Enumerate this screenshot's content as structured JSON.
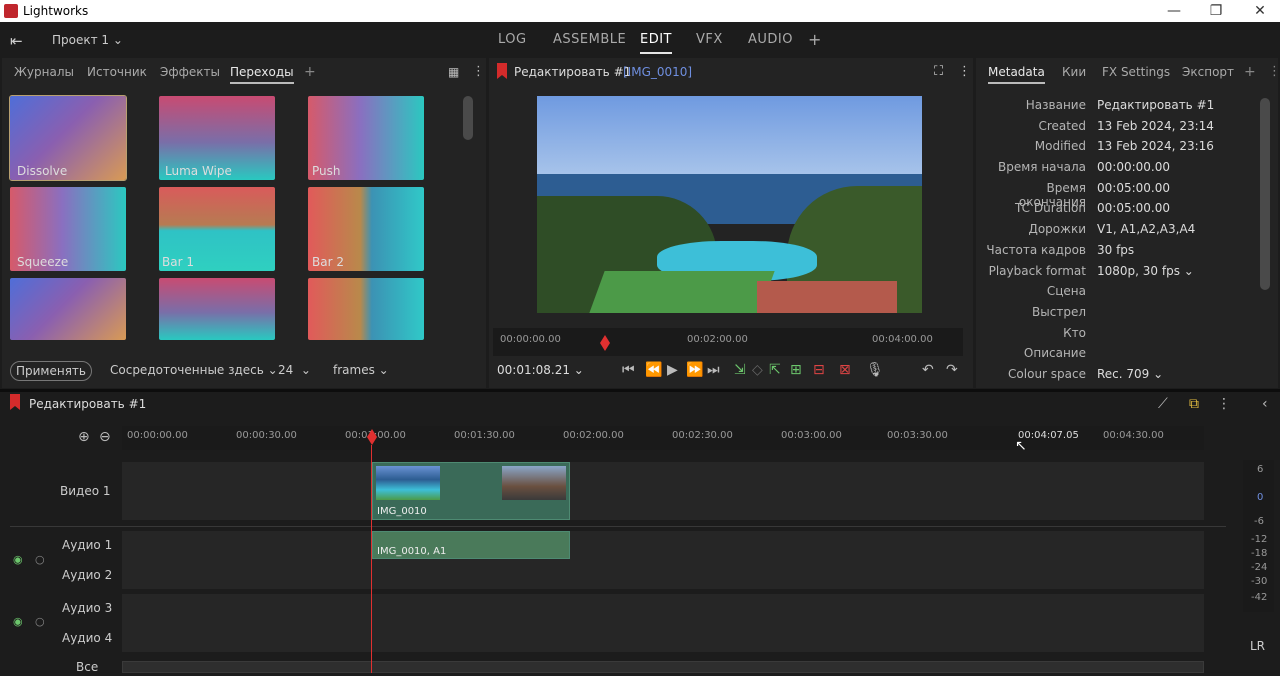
{
  "window": {
    "title": "Lightworks",
    "minimize": "—",
    "maximize": "❐",
    "close": "✕"
  },
  "topbar": {
    "project": "Проект 1",
    "nav": [
      "LOG",
      "ASSEMBLE",
      "EDIT",
      "VFX",
      "AUDIO"
    ],
    "active": "EDIT",
    "add": "+"
  },
  "left_panel": {
    "tabs": [
      "Журналы",
      "Источник",
      "Эффекты",
      "Переходы"
    ],
    "active_tab": "Переходы",
    "transitions": [
      "Dissolve",
      "Luma Wipe",
      "Push",
      "Squeeze",
      "Bar 1",
      "Bar 2"
    ],
    "apply": "Применять",
    "centered": "Сосредоточенные здесь",
    "duration": "24",
    "unit": "frames"
  },
  "viewer": {
    "title": "Редактировать #1",
    "clip": "[IMG_0010]",
    "ruler": [
      "00:00:00.00",
      "00:02:00.00",
      "00:04:00.00"
    ],
    "timecode": "00:01:08.21"
  },
  "metadata": {
    "tabs": [
      "Metadata",
      "Кии",
      "FX Settings",
      "Экспорт"
    ],
    "active_tab": "Metadata",
    "rows": [
      {
        "label": "Название",
        "value": "Редактировать #1"
      },
      {
        "label": "Created",
        "value": "13 Feb 2024, 23:14"
      },
      {
        "label": "Modified",
        "value": "13 Feb 2024, 23:16"
      },
      {
        "label": "Время начала",
        "value": "00:00:00.00"
      },
      {
        "label": "Время окончания",
        "value": "00:05:00.00"
      },
      {
        "label": "TC Duration",
        "value": "00:05:00.00"
      },
      {
        "label": "Дорожки",
        "value": "V1, A1,A2,A3,A4"
      },
      {
        "label": "Частота кадров",
        "value": "30 fps"
      },
      {
        "label": "Playback format",
        "value": "1080p, 30 fps ⌄"
      },
      {
        "label": "Сцена",
        "value": ""
      },
      {
        "label": "Выстрел",
        "value": ""
      },
      {
        "label": "Кто",
        "value": ""
      },
      {
        "label": "Описание",
        "value": ""
      },
      {
        "label": "Colour space",
        "value": "Rec. 709 ⌄"
      }
    ]
  },
  "timeline": {
    "title": "Редактировать #1",
    "ticks": [
      "00:00:00.00",
      "00:00:30.00",
      "00:01:00.00",
      "00:01:30.00",
      "00:02:00.00",
      "00:02:30.00",
      "00:03:00.00",
      "00:03:30.00",
      "00:04:07.05",
      "00:04:30.00"
    ],
    "tracks": {
      "video1": "Видео 1",
      "audio1": "Аудио 1",
      "audio2": "Аудио 2",
      "audio3": "Аудио 3",
      "audio4": "Аудио 4",
      "all": "Все"
    },
    "video_clip": "IMG_0010",
    "audio_clip": "IMG_0010, A1",
    "meter": [
      "6",
      "0",
      "-6",
      "-12",
      "-18",
      "-24",
      "-30",
      "-42"
    ],
    "lr": "LR"
  },
  "colors": {
    "accent": "#e03030",
    "clip": "#3a6a58"
  }
}
